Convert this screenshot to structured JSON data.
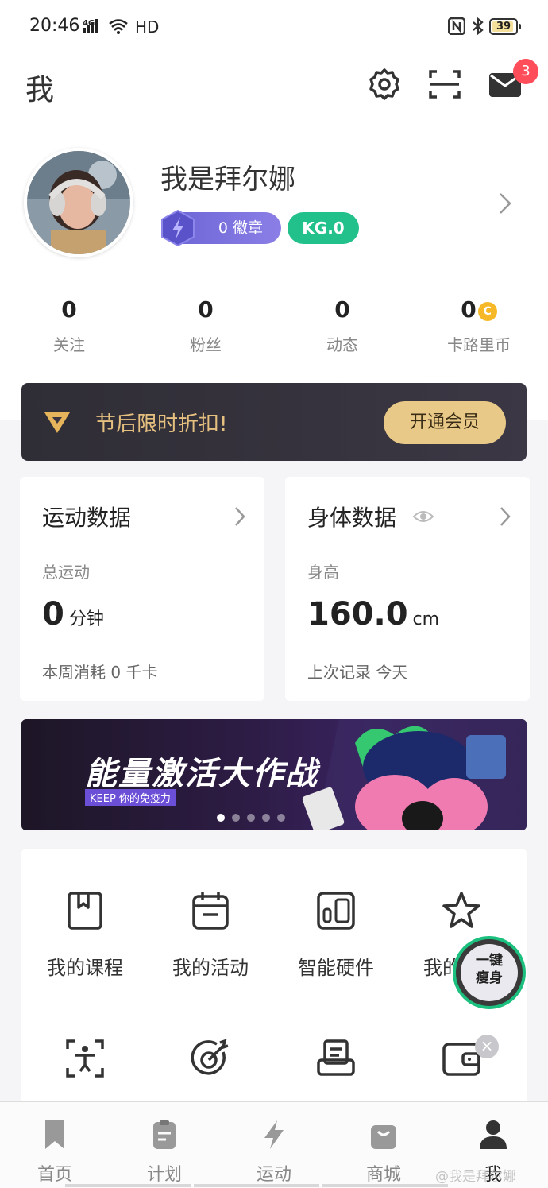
{
  "status_bar": {
    "time": "20:46",
    "network": "4G",
    "wifi_label": "HD",
    "battery": "39"
  },
  "header": {
    "title": "我",
    "mail_badge": "3",
    "icons": [
      "settings-icon",
      "scan-icon",
      "mail-icon"
    ]
  },
  "profile": {
    "name": "我是拜尔娜",
    "badge_label": "0 徽章",
    "level_label": "KG.0"
  },
  "stats": [
    {
      "value": "0",
      "label": "关注"
    },
    {
      "value": "0",
      "label": "粉丝"
    },
    {
      "value": "0",
      "label": "动态"
    },
    {
      "value": "0",
      "label": "卡路里币"
    }
  ],
  "coin_glyph": "C",
  "vip": {
    "text": "节后限时折扣!",
    "button": "开通会员"
  },
  "cards": {
    "sport": {
      "title": "运动数据",
      "sub": "总运动",
      "value": "0",
      "unit": "分钟",
      "foot": "本周消耗 0 千卡"
    },
    "body": {
      "title": "身体数据",
      "sub": "身高",
      "value": "160.0",
      "unit": "cm",
      "foot": "上次记录 今天"
    }
  },
  "promo": {
    "title": "能量激活大作战",
    "subtitle": "KEEP 你的免疫力",
    "active_dot": 1,
    "dot_count": 5
  },
  "tools": [
    {
      "label": "我的课程",
      "icon": "book-icon"
    },
    {
      "label": "我的活动",
      "icon": "calendar-icon"
    },
    {
      "label": "智能硬件",
      "icon": "devices-icon"
    },
    {
      "label": "我的",
      "icon": "star-icon"
    }
  ],
  "tools_row2_icons": [
    "body-scan-icon",
    "target-icon",
    "print-icon",
    "wallet-icon"
  ],
  "float_button": {
    "line1": "一键",
    "line2": "瘦身",
    "close": "×"
  },
  "tabs": [
    {
      "label": "首页",
      "icon": "bookmark-icon",
      "active": false
    },
    {
      "label": "计划",
      "icon": "plan-icon",
      "active": false
    },
    {
      "label": "运动",
      "icon": "lightning-icon",
      "active": false
    },
    {
      "label": "商城",
      "icon": "shop-bag-icon",
      "active": false
    },
    {
      "label": "我",
      "icon": "person-icon",
      "active": true
    }
  ],
  "watermark": "@我是拜尔娜",
  "colors": {
    "accent_green": "#22c08b",
    "badge_purple": "#6c64d6",
    "vip_gold": "#e8c987",
    "notification_red": "#ff4d5a"
  }
}
